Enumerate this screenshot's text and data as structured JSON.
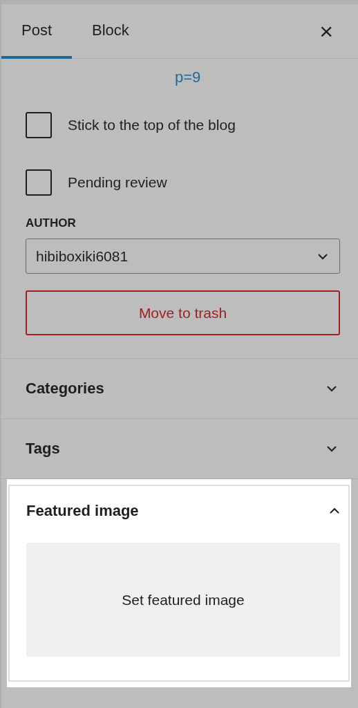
{
  "tabs": [
    {
      "label": "Post",
      "selected": true
    },
    {
      "label": "Block",
      "selected": false
    }
  ],
  "close_label": "×",
  "permalink": "p=9",
  "checkboxes": [
    {
      "label": "Stick to the top of the blog",
      "checked": false
    },
    {
      "label": "Pending review",
      "checked": false
    }
  ],
  "author": {
    "label": "AUTHOR",
    "value": "hibiboxiki6081"
  },
  "trash_button": "Move to trash",
  "panels": [
    {
      "title": "Categories",
      "expanded": false,
      "highlighted": false
    },
    {
      "title": "Tags",
      "expanded": false,
      "highlighted": false
    },
    {
      "title": "Featured image",
      "expanded": true,
      "highlighted": true,
      "action": "Set featured image"
    }
  ]
}
